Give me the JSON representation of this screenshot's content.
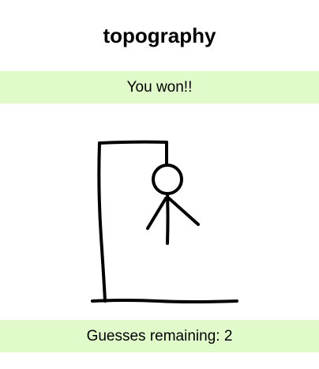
{
  "game": {
    "word": "topography",
    "status_message": "You won!!",
    "guesses_label": "Guesses remaining:",
    "guesses_remaining": 2
  }
}
